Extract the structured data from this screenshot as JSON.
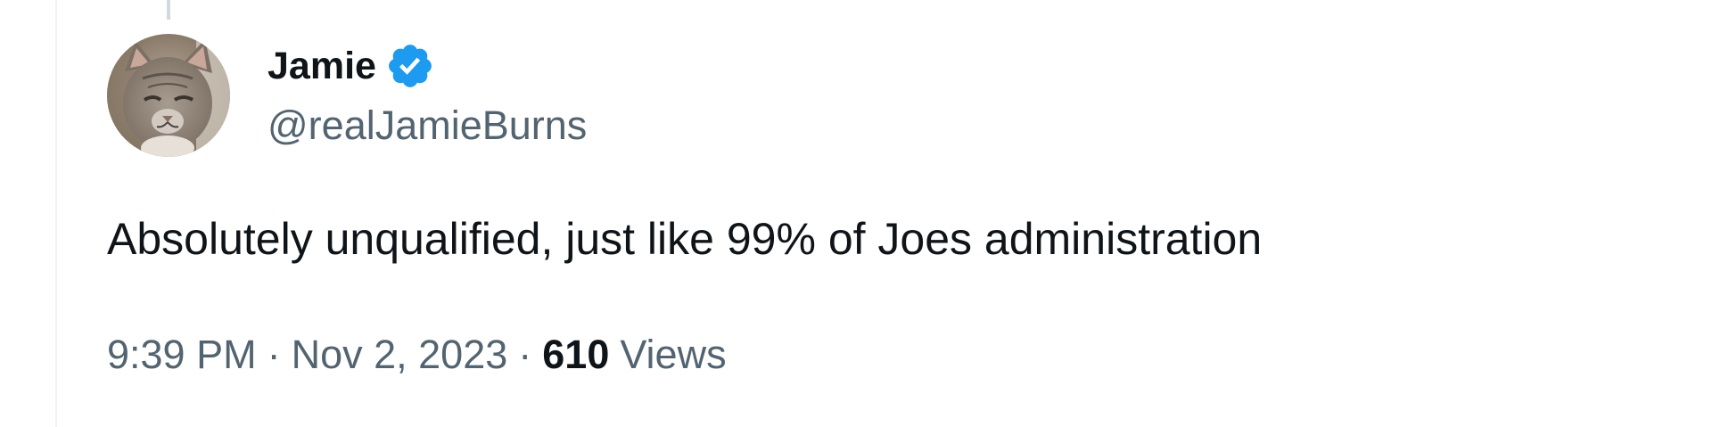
{
  "tweet": {
    "author": {
      "display_name": "Jamie",
      "handle": "@realJamieBurns",
      "verified": true,
      "avatar_icon": "cat-avatar",
      "verified_icon": "verified-badge-icon",
      "verified_color": "#1d9bf0"
    },
    "text": "Absolutely unqualified, just like 99% of Joes administration",
    "time": "9:39 PM",
    "separator": "·",
    "date": "Nov 2, 2023",
    "views_count": "610",
    "views_label": "Views"
  },
  "colors": {
    "primary_text": "#0f1419",
    "secondary_text": "#536471",
    "thread_line": "#cfd9de",
    "border": "#eff3f4"
  }
}
